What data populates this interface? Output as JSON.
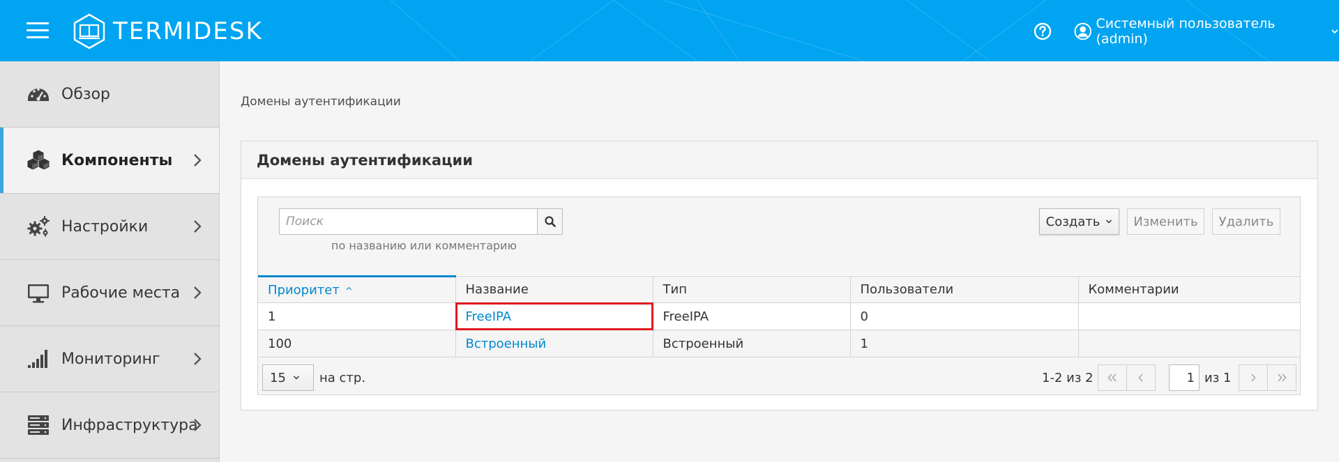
{
  "header": {
    "logo_text": "TERMIDESK",
    "user_label": "Системный пользователь (admin)",
    "colors": {
      "bar": "#00a4f0",
      "text": "#ffffff"
    }
  },
  "sidebar": {
    "items": [
      {
        "label": "Обзор",
        "icon": "dashboard-gauge-icon",
        "active": false,
        "has_children": false
      },
      {
        "label": "Компоненты",
        "icon": "cubes-icon",
        "active": true,
        "has_children": true
      },
      {
        "label": "Настройки",
        "icon": "gears-icon",
        "active": false,
        "has_children": true
      },
      {
        "label": "Рабочие места",
        "icon": "desktop-monitor-icon",
        "active": false,
        "has_children": true
      },
      {
        "label": "Мониторинг",
        "icon": "signal-bars-icon",
        "active": false,
        "has_children": true
      },
      {
        "label": "Инфраструктура",
        "icon": "server-stack-icon",
        "active": false,
        "has_children": true
      }
    ],
    "accent_color": "#39a5dc"
  },
  "breadcrumb": "Домены аутентификации",
  "card": {
    "title": "Домены аутентификации"
  },
  "toolbar": {
    "search_placeholder": "Поиск",
    "search_hint": "по названию или комментарию",
    "create_label": "Создать",
    "edit_label": "Изменить",
    "delete_label": "Удалить"
  },
  "table": {
    "columns": [
      "Приоритет",
      "Название",
      "Тип",
      "Пользователи",
      "Комментарии"
    ],
    "sorted_column": "Приоритет",
    "rows": [
      {
        "priority": "1",
        "name": "FreeIPA",
        "type": "FreeIPA",
        "users": "0",
        "comment": ""
      },
      {
        "priority": "100",
        "name": "Встроенный",
        "type": "Встроенный",
        "users": "1",
        "comment": ""
      }
    ],
    "link_color": "#0088ce",
    "highlight_color": "#e0191f"
  },
  "pagination": {
    "per_page": "15",
    "per_page_label": "на стр.",
    "range": "1-2 из 2",
    "current_page": "1",
    "of_label": "из 1"
  }
}
